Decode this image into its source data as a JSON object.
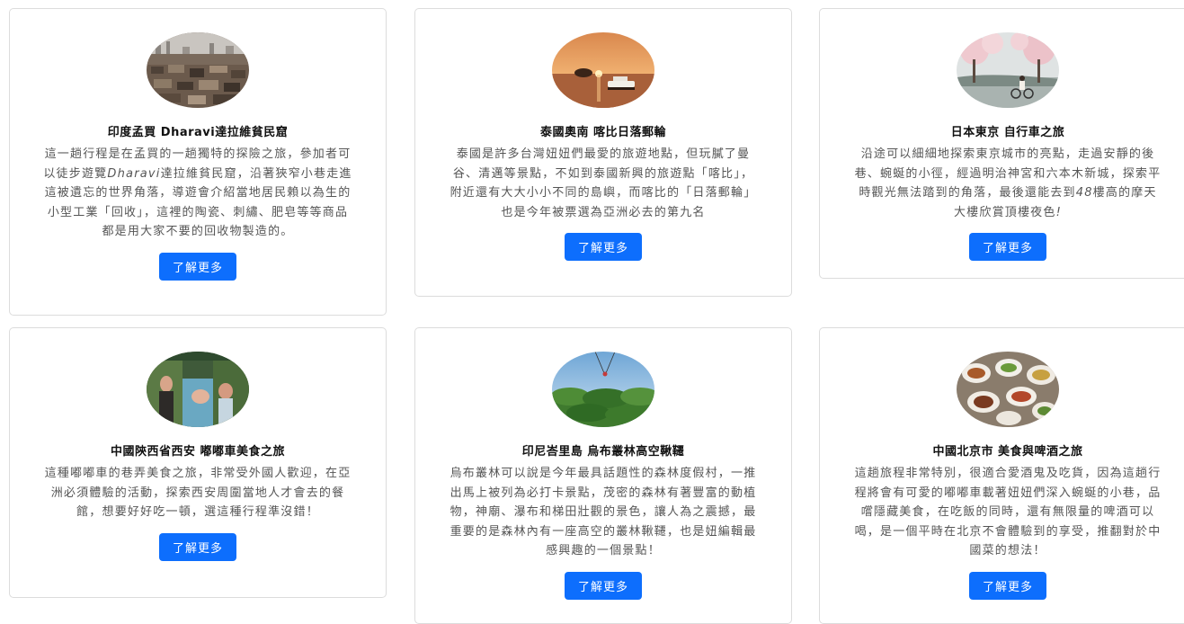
{
  "cards": [
    {
      "title": "印度孟買 Dharavi達拉維貧民窟",
      "desc_pre": "這一趟行程是在孟買的一趟獨特的探險之旅，參加者可以徒步遊覽",
      "desc_em": "Dharavi",
      "desc_post": "達拉維貧民窟，沿著狹窄小巷走進這被遺忘的世界角落，導遊會介紹當地居民賴以為生的小型工業「回收」，這裡的陶瓷、刺繡、肥皂等等商品都是用大家不要的回收物製造的。",
      "button": "了解更多"
    },
    {
      "title": "泰國奧南 喀比日落郵輪",
      "desc": "泰國是許多台灣妞妞們最愛的旅遊地點，但玩膩了曼谷、清邁等景點，不如到泰國新興的旅遊點「喀比」，附近還有大大小小不同的島嶼，而喀比的「日落郵輪」也是今年被票選為亞洲必去的第九名",
      "button": "了解更多"
    },
    {
      "title": "日本東京 自行車之旅",
      "desc_pre": "沿途可以細細地探索東京城市的亮點，走過安靜的後巷、蜿蜒的小徑，經過明治神宮和六本木新城，探索平時觀光無法踏到的角落，最後還能去到",
      "desc_em": "48",
      "desc_post": "樓高的摩天大樓欣賞頂樓夜色",
      "desc_em2": "!",
      "button": "了解更多"
    },
    {
      "title": "中國陝西省西安 嘟嘟車美食之旅",
      "desc": "這種嘟嘟車的巷弄美食之旅，非常受外國人歡迎，在亞洲必須體驗的活動，探索西安周圍當地人才會去的餐館，想要好好吃一頓，選這種行程準沒錯！",
      "button": "了解更多"
    },
    {
      "title": "印尼峇里島 烏布叢林高空鞦韆",
      "desc": "烏布叢林可以說是今年最具話題性的森林度假村，一推出馬上被列為必打卡景點，茂密的森林有著豐富的動植物，神廟、瀑布和梯田壯觀的景色，讓人為之震撼，最重要的是森林內有一座高空的叢林鞦韆，也是妞編輯最感興趣的一個景點！",
      "button": "了解更多"
    },
    {
      "title": "中國北京市 美食與啤酒之旅",
      "desc": "這趟旅程非常特別，很適合愛酒鬼及吃貨，因為這趟行程將會有可愛的嘟嘟車載著妞妞們深入蜿蜒的小巷，品嚐隱藏美食，在吃飯的同時，還有無限量的啤酒可以喝，是一個平時在北京不會體驗到的享受，推翻對於中國菜的想法！",
      "button": "了解更多"
    }
  ]
}
